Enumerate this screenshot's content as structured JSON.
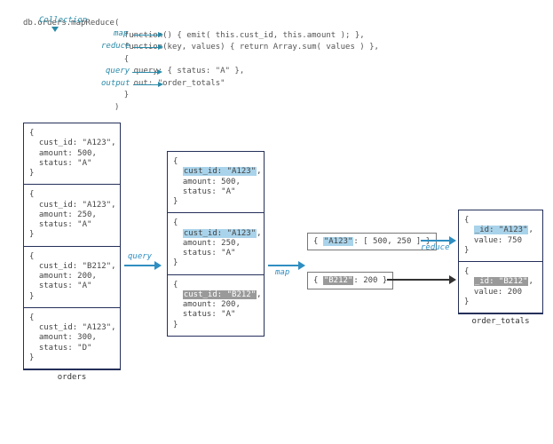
{
  "labels": {
    "collection": "Collection",
    "map": "map",
    "reduce": "reduce",
    "query": "query",
    "output": "output"
  },
  "code": {
    "line1": "db.orders.mapReduce(",
    "map_fn": "                     function() { emit( this.cust_id, this.amount ); },",
    "reduce_fn": "                     function(key, values) { return Array.sum( values ) },",
    "opts_open": "                     {",
    "opts_q": "                       query: { status: \"A\" },",
    "opts_out": "                       out: \"order_totals\"",
    "opts_close": "                     }",
    "close": "                   )"
  },
  "orders_title": "orders",
  "orders": [
    "{\n  cust_id: \"A123\",\n  amount: 500,\n  status: \"A\"\n}",
    "{\n  cust_id: \"A123\",\n  amount: 250,\n  status: \"A\"\n}",
    "{\n  cust_id: \"B212\",\n  amount: 200,\n  status: \"A\"\n}",
    "{\n  cust_id: \"A123\",\n  amount: 300,\n  status: \"D\"\n}"
  ],
  "filtered": {
    "d0": {
      "open": "{",
      "k": "cust_id: \"A123\"",
      "rest": ",\n  amount: 500,\n  status: \"A\"\n}"
    },
    "d1": {
      "open": "{",
      "k": "cust_id: \"A123\"",
      "rest": ",\n  amount: 250,\n  status: \"A\"\n}"
    },
    "d2": {
      "open": "{",
      "k": "cust_id: \"B212\"",
      "rest": ",\n  amount: 200,\n  status: \"A\"\n}"
    }
  },
  "mapped": {
    "a": {
      "open": "{ ",
      "key": "\"A123\"",
      "rest": ": [ 500, 250 ] }"
    },
    "b": {
      "open": "{ ",
      "key": "\"B212\"",
      "rest": ": 200 }"
    }
  },
  "result_title": "order_totals",
  "result": {
    "a": {
      "open": "{\n  ",
      "id": "_id: \"A123\"",
      "rest": ",\n  value: 750\n}"
    },
    "b": {
      "open": "{\n  ",
      "id": "_id: \"B212\"",
      "rest": ",\n  value: 200\n}"
    }
  },
  "stage": {
    "query": "query",
    "map": "map",
    "reduce": "reduce"
  }
}
